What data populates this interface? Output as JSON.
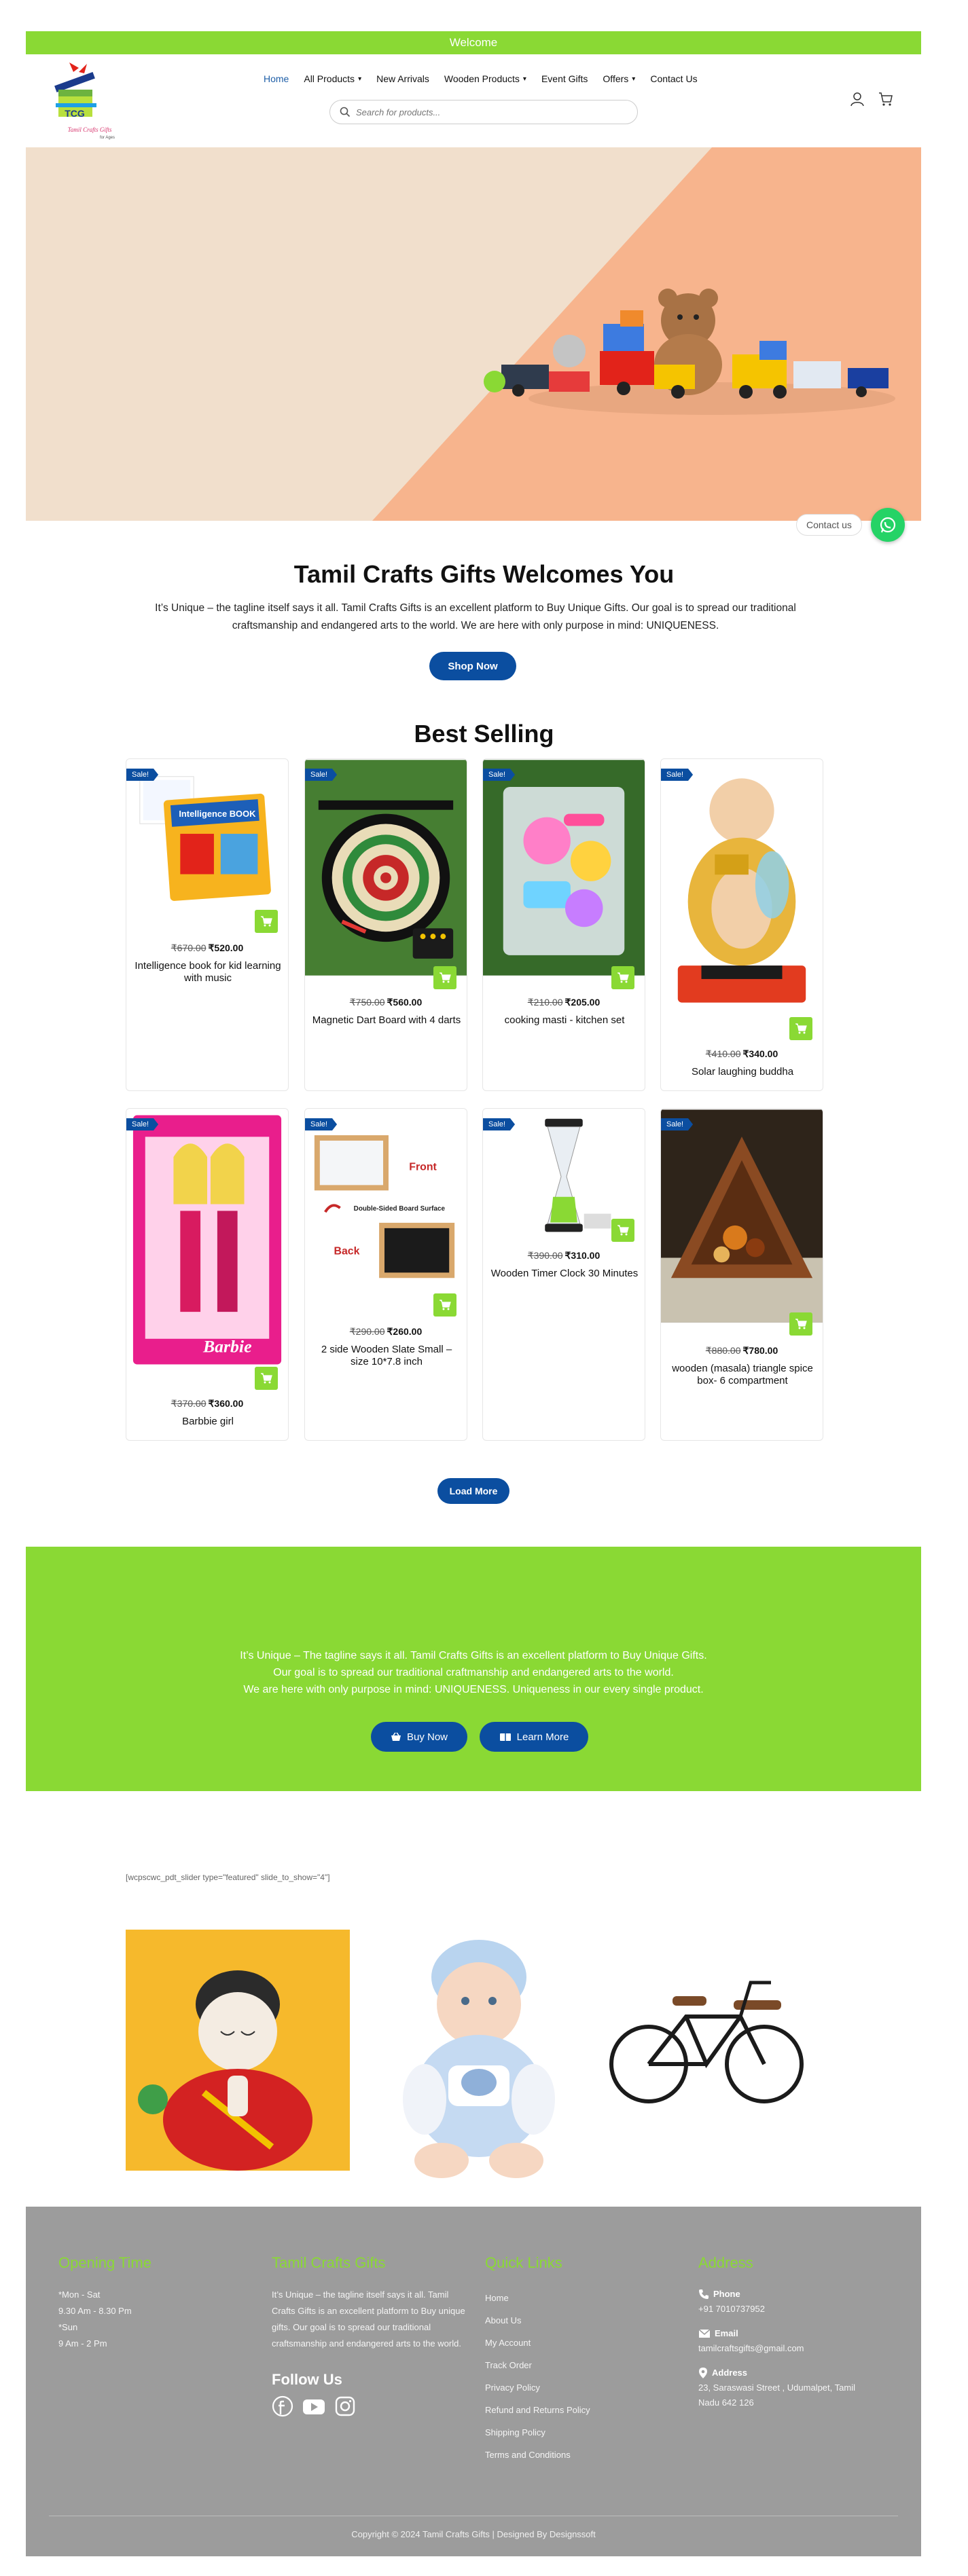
{
  "topbar": {
    "text": "Welcome"
  },
  "brand": {
    "logo_letters": "TCG",
    "logo_tagline": "Tamil Crafts Gifts",
    "logo_sub": "for Ages"
  },
  "nav": {
    "items": [
      {
        "label": "Home",
        "active": true,
        "dropdown": false
      },
      {
        "label": "All Products",
        "dropdown": true
      },
      {
        "label": "New Arrivals",
        "dropdown": false
      },
      {
        "label": "Wooden Products",
        "dropdown": true
      },
      {
        "label": "Event Gifts",
        "dropdown": false
      },
      {
        "label": "Offers",
        "dropdown": true
      },
      {
        "label": "Contact Us",
        "dropdown": false
      }
    ]
  },
  "search": {
    "placeholder": "Search for products..."
  },
  "contact": {
    "label": "Contact us"
  },
  "welcome": {
    "title": "Tamil Crafts Gifts Welcomes You",
    "text": "It’s Unique – the tagline itself says it all. Tamil Crafts Gifts is an excellent platform to Buy Unique Gifts. Our goal is to spread our traditional craftsmanship and endangered arts to the world. We are here with only purpose in mind: UNIQUENESS.",
    "button": "Shop Now"
  },
  "best_selling": {
    "title": "Best Selling",
    "sale_label": "Sale!",
    "products": [
      {
        "name": "Intelligence book for kid learning with music",
        "old_price": "₹670.00",
        "price": "₹520.00",
        "image": "book"
      },
      {
        "name": "Magnetic Dart Board with 4 darts",
        "old_price": "₹750.00",
        "price": "₹560.00",
        "image": "dart"
      },
      {
        "name": "cooking masti - kitchen set",
        "old_price": "₹210.00",
        "price": "₹205.00",
        "image": "kitchen"
      },
      {
        "name": "Solar laughing buddha",
        "old_price": "₹410.00",
        "price": "₹340.00",
        "image": "buddha"
      },
      {
        "name": "Barbbie girl",
        "old_price": "₹370.00",
        "price": "₹360.00",
        "image": "barbie"
      },
      {
        "name": "2 side Wooden Slate Small – size 10*7.8 inch",
        "old_price": "₹290.00",
        "price": "₹260.00",
        "image": "slate"
      },
      {
        "name": "Wooden Timer Clock 30 Minutes",
        "old_price": "₹390.00",
        "price": "₹310.00",
        "image": "timer"
      },
      {
        "name": "wooden (masala) triangle spice box- 6 compartment",
        "old_price": "₹880.00",
        "price": "₹780.00",
        "image": "spice"
      }
    ],
    "slate_labels": {
      "front": "Front",
      "middle": "Double-Sided Board Surface",
      "back": "Back"
    },
    "book_label": "Intelligence BOOK",
    "barbie_label": "Barbie",
    "load_more": "Load More"
  },
  "banner": {
    "line1": "It’s Unique – The tagline says it all. Tamil Crafts Gifts is  an excellent platform to Buy Unique Gifts.",
    "line2": "Our goal is to spread our traditional craftmanship and endangered arts to the world.",
    "line3": "We are here with only purpose in mind: UNIQUENESS. Uniqueness in our every single product.",
    "buy_now": "Buy Now",
    "learn_more": "Learn More"
  },
  "shortcode": "[wcpscwc_pdt_slider type=\"featured\" slide_to_show=\"4\"]",
  "featured": [
    "buddha-idol",
    "baby-doll",
    "bicycle-model"
  ],
  "footer": {
    "opening": {
      "title": "Opening Time",
      "lines": [
        "*Mon - Sat",
        "9.30 Am - 8.30 Pm",
        "*Sun",
        " 9 Am - 2 Pm"
      ]
    },
    "about": {
      "title": "Tamil Crafts Gifts",
      "text": "It’s Unique – the tagline itself says it all. Tamil Crafts Gifts is an excellent platform to Buy unique gifts. Our goal is to spread our traditional craftsmanship and endangered arts to the world.",
      "follow": "Follow Us"
    },
    "quick": {
      "title": "Quick Links",
      "links": [
        "Home",
        "About Us",
        "My Account",
        "Track Order",
        "Privacy Policy",
        "Refund and Returns Policy",
        "Shipping Policy",
        "Terms and Conditions"
      ]
    },
    "address": {
      "title": "Address",
      "phone_label": "Phone",
      "phone": "+91 7010737952",
      "email_label": "Email",
      "email": "tamilcraftsgifts@gmail.com",
      "address_label": "Address",
      "address": "23, Saraswasi Street , Udumalpet, Tamil Nadu 642 126"
    },
    "copyright": "Copyright © 2024 Tamil Crafts Gifts | Designed By Designssoft"
  },
  "colors": {
    "brand_green": "#8ad934",
    "brand_blue": "#0b4ea0",
    "hero_peach": "#f7b48d",
    "hero_cream": "#f1dfcc",
    "footer_grey": "#9c9c9c"
  }
}
